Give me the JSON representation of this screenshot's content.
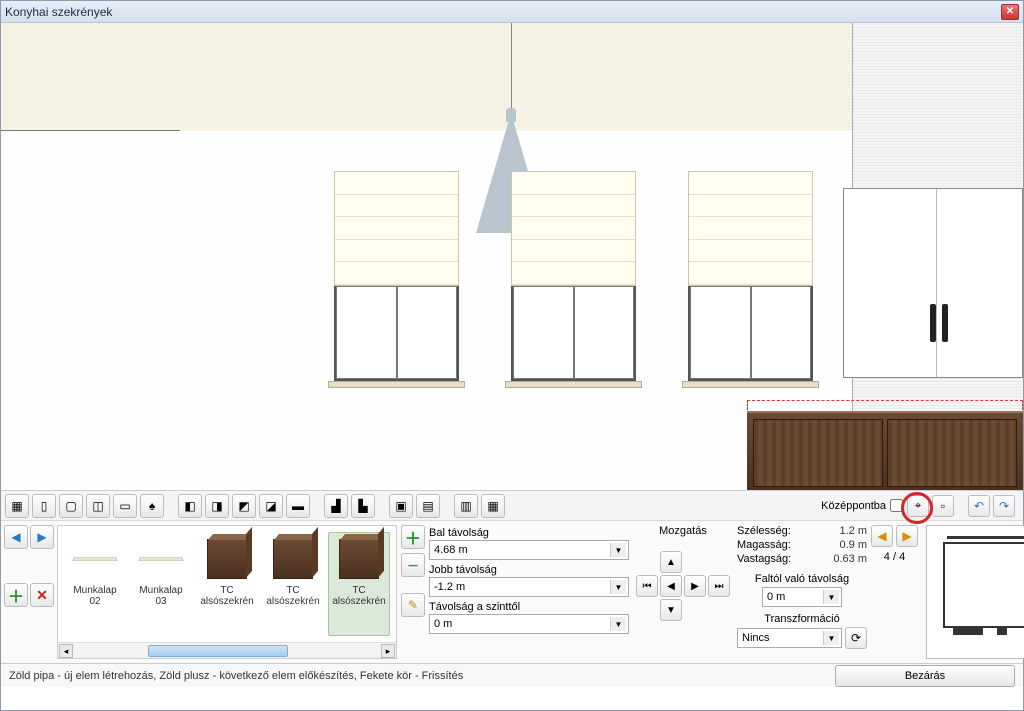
{
  "window": {
    "title": "Konyhai szekrények"
  },
  "iconbar": {
    "center_to_label": "Középpontba",
    "center_checked": false
  },
  "thumbs": {
    "items": [
      {
        "name": "Munkalap 02",
        "kind": "slab"
      },
      {
        "name": "Munkalap 03",
        "kind": "slab"
      },
      {
        "name": "TC alsószekrén",
        "kind": "cab"
      },
      {
        "name": "TC alsószekrén",
        "kind": "cab"
      },
      {
        "name": "TC alsószekrén",
        "kind": "cab",
        "selected": true
      }
    ]
  },
  "params": {
    "left_dist_label": "Bal távolság",
    "left_dist_value": "4.68 m",
    "right_dist_label": "Jobb távolság",
    "right_dist_value": "-1.2 m",
    "level_dist_label": "Távolság a szinttől",
    "level_dist_value": "0 m"
  },
  "move": {
    "label": "Mozgatás"
  },
  "info": {
    "width_label": "Szélesség:",
    "width_value": "1.2 m",
    "height_label": "Magasság:",
    "height_value": "0.9 m",
    "depth_label": "Vastagság:",
    "depth_value": "0.63 m",
    "wall_label": "Faltól való távolság",
    "wall_value": "0 m",
    "trans_label": "Transzformáció",
    "trans_value": "Nincs",
    "page": "4 / 4"
  },
  "footer": {
    "hint": "Zöld pipa - új elem létrehozás, Zöld plusz - következő elem előkészítés, Fekete kör - Frissítés",
    "close": "Bezárás"
  }
}
